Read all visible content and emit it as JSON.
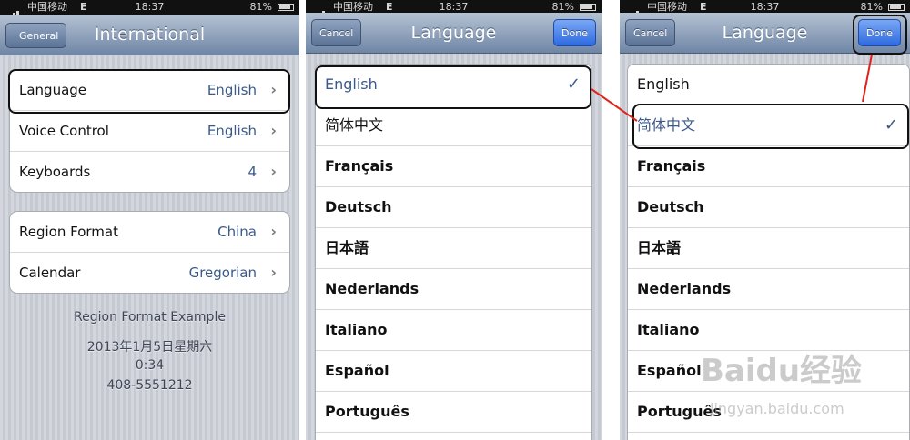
{
  "statusbar": {
    "carrier": "中国移动",
    "network": "E",
    "time": "18:37",
    "battery": "81%"
  },
  "panel1": {
    "nav": {
      "back_label": "General",
      "title": "International"
    },
    "group1": [
      {
        "label": "Language",
        "value": "English"
      },
      {
        "label": "Voice Control",
        "value": "English"
      },
      {
        "label": "Keyboards",
        "value": "4"
      }
    ],
    "group2": [
      {
        "label": "Region Format",
        "value": "China"
      },
      {
        "label": "Calendar",
        "value": "Gregorian"
      }
    ],
    "example": {
      "heading": "Region Format Example",
      "date": "2013年1月5日星期六",
      "time": "0:34",
      "phone": "408-5551212"
    }
  },
  "panel2": {
    "nav": {
      "cancel_label": "Cancel",
      "title": "Language",
      "done_label": "Done"
    },
    "languages": [
      "English",
      "简体中文",
      "Français",
      "Deutsch",
      "日本語",
      "Nederlands",
      "Italiano",
      "Español",
      "Português"
    ],
    "selected": "English"
  },
  "panel3": {
    "nav": {
      "cancel_label": "Cancel",
      "title": "Language",
      "done_label": "Done"
    },
    "languages": [
      "English",
      "简体中文",
      "Français",
      "Deutsch",
      "日本語",
      "Nederlands",
      "Italiano",
      "Español",
      "Português"
    ],
    "selected": "简体中文"
  },
  "watermark": {
    "logo": "Baidu经验",
    "url": "jingyan.baidu.com"
  },
  "colors": {
    "annotation_arrow": "#e0231b",
    "selected_text": "#3b5a8a",
    "done_button": "#2e6be0"
  },
  "icons": {
    "chevron": "chevron-right-icon",
    "check": "checkmark-icon",
    "signal": "signal-bars-icon",
    "battery": "battery-icon"
  }
}
